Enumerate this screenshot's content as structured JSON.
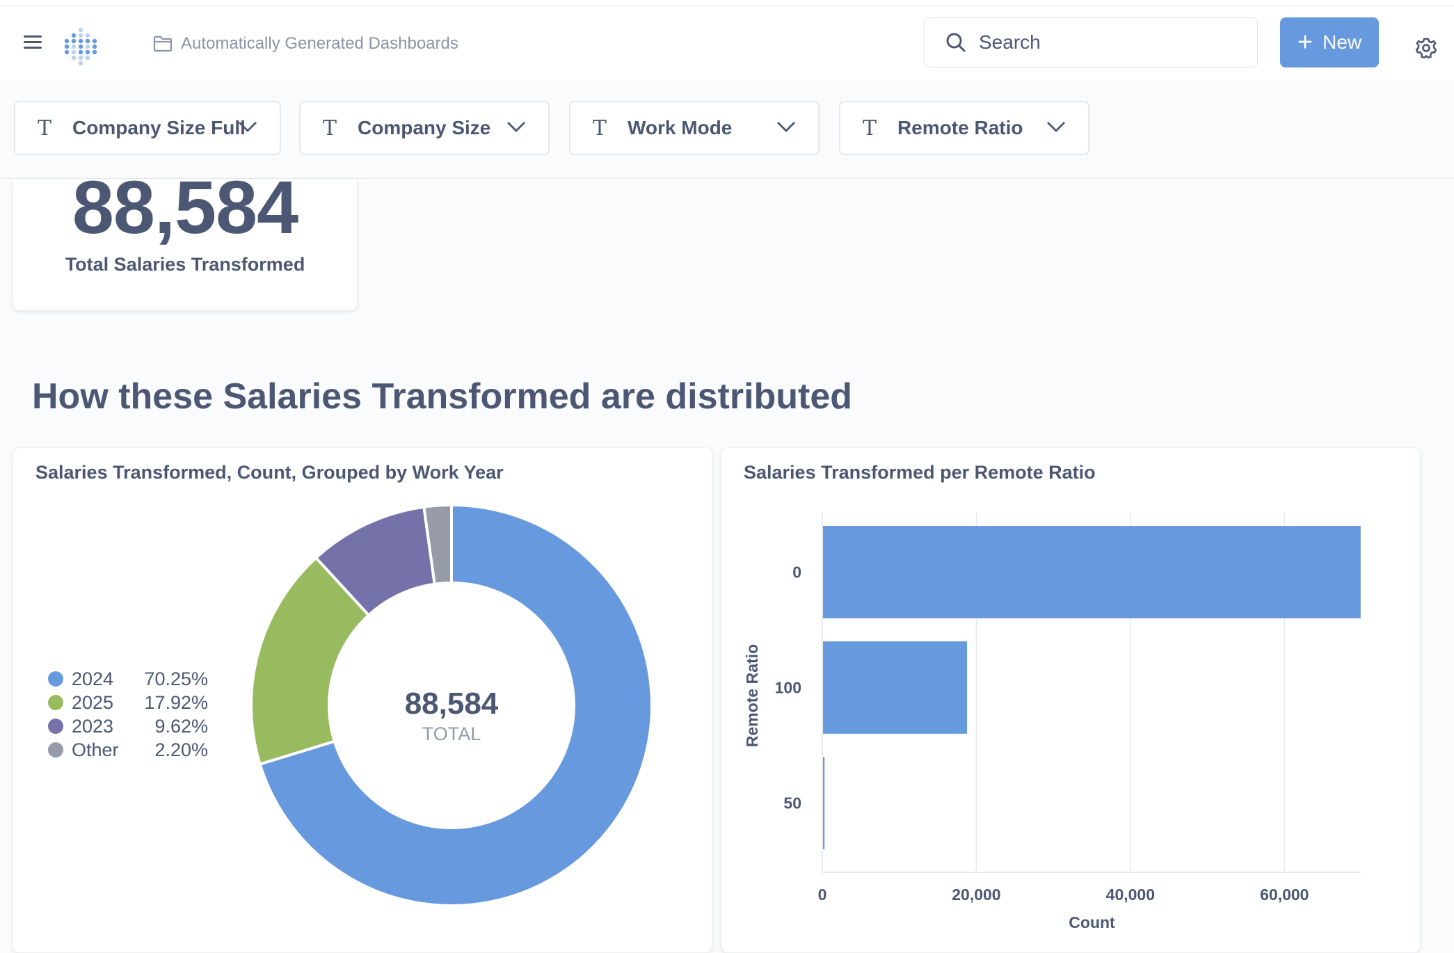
{
  "header": {
    "breadcrumb": "Automatically Generated Dashboards",
    "search_placeholder": "Search",
    "new_button": "New"
  },
  "filters": [
    {
      "label": "Company Size Full"
    },
    {
      "label": "Company Size"
    },
    {
      "label": "Work Mode"
    },
    {
      "label": "Remote Ratio"
    }
  ],
  "scalar": {
    "value": "88,584",
    "label": "Total Salaries Transformed"
  },
  "section_heading": "How these Salaries Transformed are distributed",
  "donut_card": {
    "title": "Salaries Transformed, Count, Grouped by Work Year",
    "center_value": "88,584",
    "center_label": "TOTAL",
    "legend": [
      {
        "name": "2024",
        "pct": "70.25%",
        "color": "#6699dd"
      },
      {
        "name": "2025",
        "pct": "17.92%",
        "color": "#97bb5e"
      },
      {
        "name": "2023",
        "pct": "9.62%",
        "color": "#7472a9"
      },
      {
        "name": "Other",
        "pct": "2.20%",
        "color": "#979ba8"
      }
    ]
  },
  "bar_card": {
    "title": "Salaries Transformed per Remote Ratio"
  },
  "chart_data": [
    {
      "type": "pie",
      "title": "Salaries Transformed, Count, Grouped by Work Year",
      "categories": [
        "2024",
        "2025",
        "2023",
        "Other"
      ],
      "values": [
        70.25,
        17.92,
        9.62,
        2.2
      ],
      "total": 88584
    },
    {
      "type": "bar",
      "orientation": "horizontal",
      "title": "Salaries Transformed per Remote Ratio",
      "categories": [
        "0",
        "100",
        "50"
      ],
      "values": [
        69800,
        18700,
        200
      ],
      "xlabel": "Count",
      "ylabel": "Remote Ratio",
      "xlim": [
        0,
        70000
      ],
      "xticks": [
        "0",
        "20,000",
        "40,000",
        "60,000"
      ],
      "grid": true,
      "color": "#6699dd"
    }
  ]
}
